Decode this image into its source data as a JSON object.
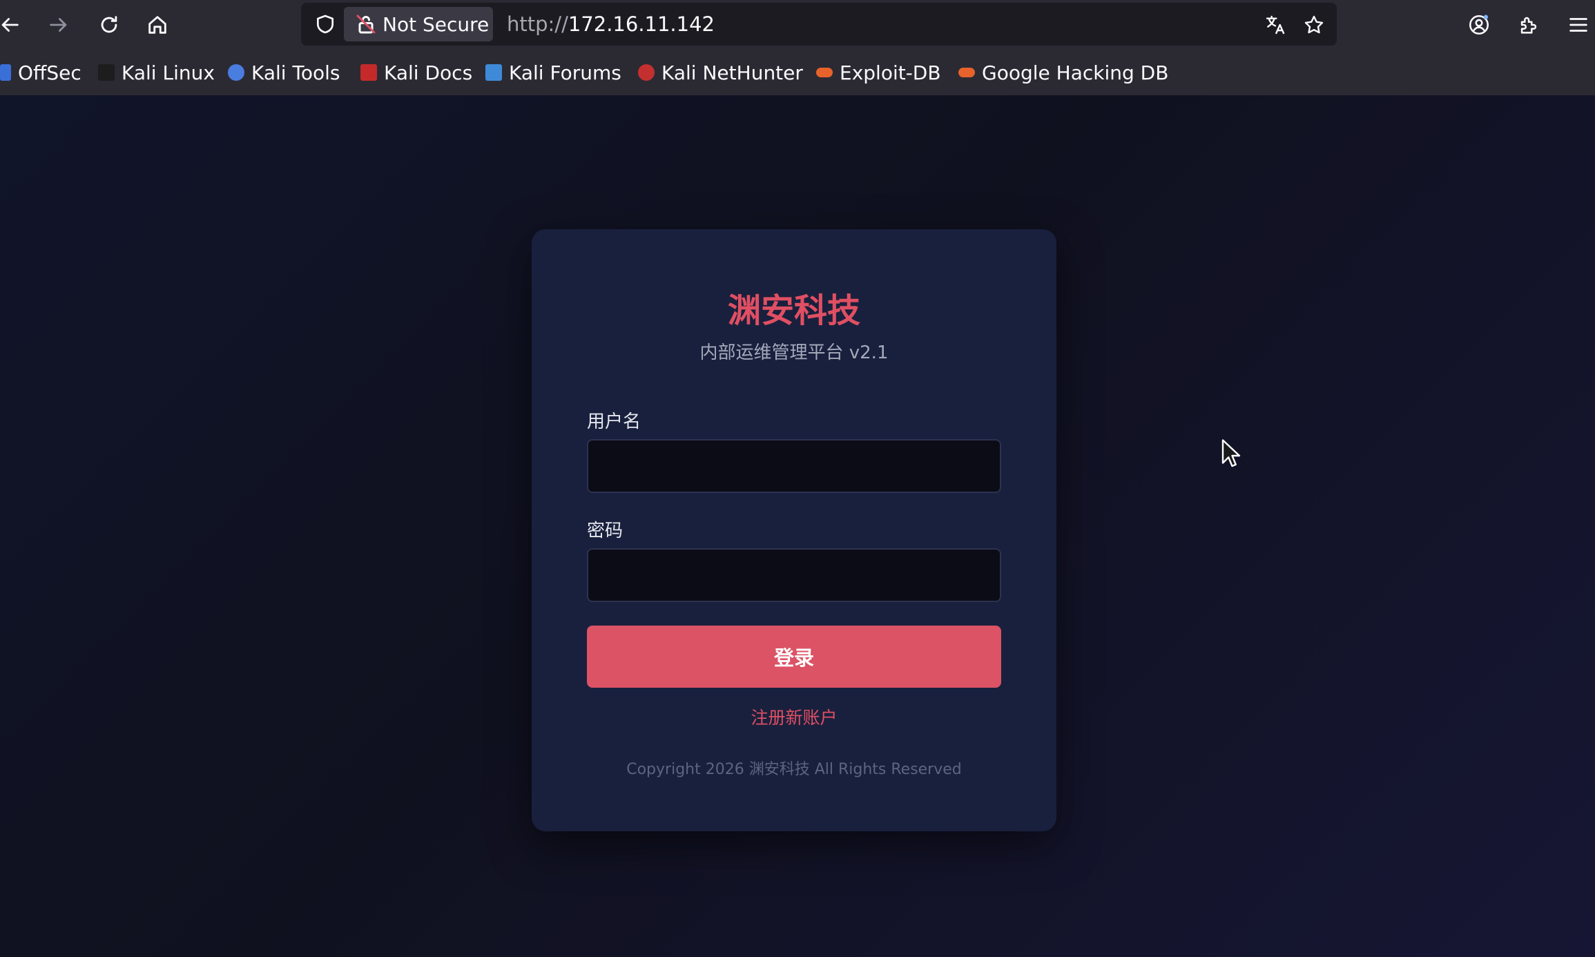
{
  "browser": {
    "security_label": "Not Secure",
    "url_scheme": "http://",
    "url_host": "172.16.11.142",
    "icons": [
      "back-arrow-icon",
      "forward-arrow-icon",
      "reload-icon",
      "home-icon",
      "shield-icon",
      "lock-slash-icon",
      "translate-icon",
      "star-icon",
      "account-icon",
      "extensions-icon",
      "menu-icon"
    ]
  },
  "bookmarks": [
    {
      "label": "OffSec",
      "color": "#3a6fd8"
    },
    {
      "label": "Kali Linux",
      "color": "#1d1d1d"
    },
    {
      "label": "Kali Tools",
      "color": "#4a7de0"
    },
    {
      "label": "Kali Docs",
      "color": "#c42a2a"
    },
    {
      "label": "Kali Forums",
      "color": "#3f8ad8"
    },
    {
      "label": "Kali NetHunter",
      "color": "#c43030"
    },
    {
      "label": "Exploit-DB",
      "color": "#e8622c"
    },
    {
      "label": "Google Hacking DB",
      "color": "#e8622c"
    }
  ],
  "login": {
    "brand": "渊安科技",
    "subtitle": "内部运维管理平台 v2.1",
    "username_label": "用户名",
    "username_value": "",
    "password_label": "密码",
    "password_value": "",
    "submit_label": "登录",
    "register_link": "注册新账户",
    "copyright": "Copyright 2026 渊安科技 All Rights Reserved"
  },
  "colors": {
    "accent": "#db5365",
    "card_bg": "#19203d",
    "page_bg": "#10111f",
    "chrome_bg": "#2b2a33"
  }
}
